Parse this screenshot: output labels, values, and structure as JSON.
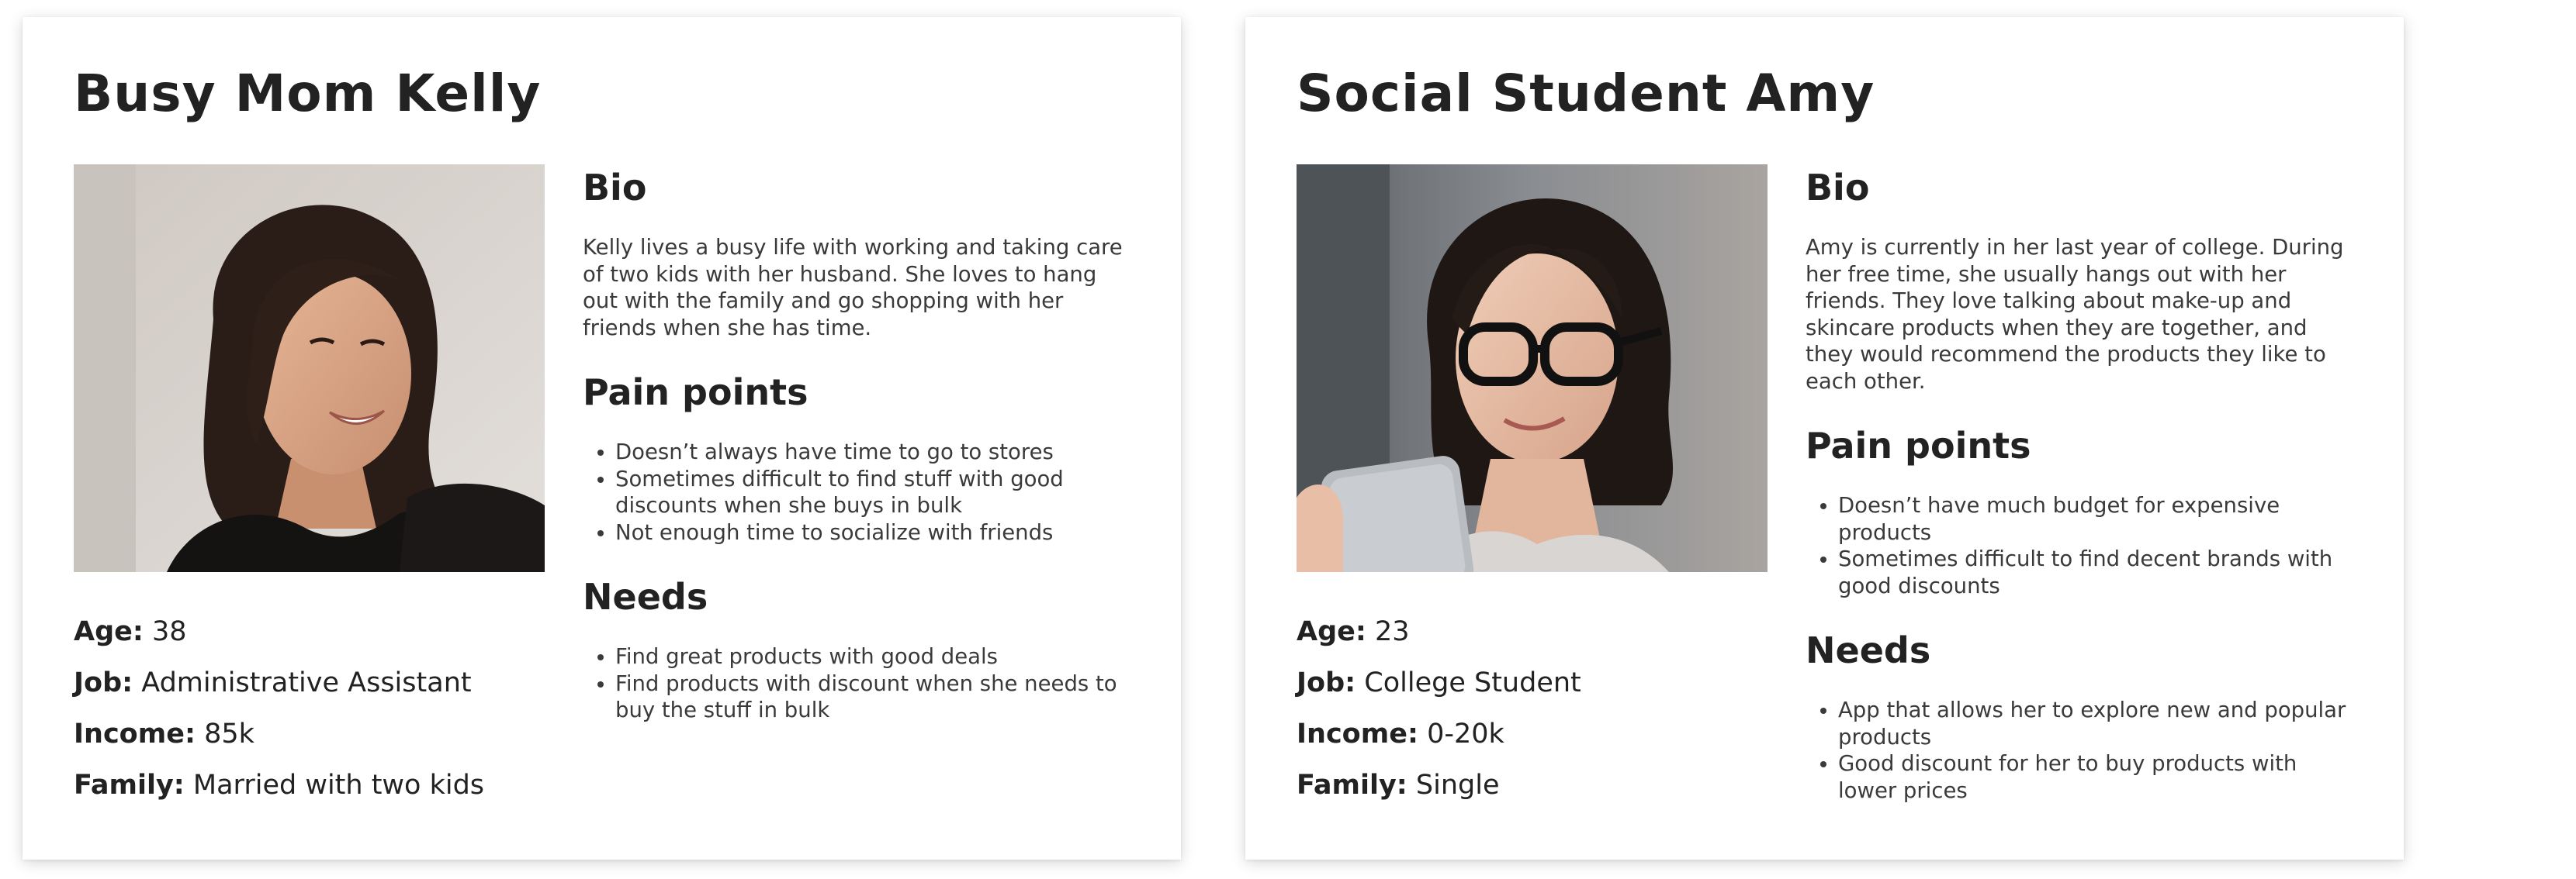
{
  "personas": [
    {
      "name": "Busy Mom Kelly",
      "photo_alt": "portrait-kelly",
      "facts": [
        {
          "key": "Age:",
          "value": "38"
        },
        {
          "key": "Job:",
          "value": "Administrative Assistant"
        },
        {
          "key": "Income:",
          "value": "85k"
        },
        {
          "key": "Family:",
          "value": "Married with two kids"
        }
      ],
      "bio_heading": "Bio",
      "bio": "Kelly lives a busy life with working and taking care of two kids with her husband. She loves to hang out with the family and go shopping with her friends when she has time.",
      "pain_heading": "Pain points",
      "pain_points": [
        "Doesn’t always have time to go to stores",
        "Sometimes difficult to find stuff with good discounts when she buys in bulk",
        "Not enough time to socialize with friends"
      ],
      "needs_heading": "Needs",
      "needs": [
        "Find great products with good deals",
        "Find products with discount when she needs to buy the stuff in bulk"
      ]
    },
    {
      "name": "Social Student Amy",
      "photo_alt": "portrait-amy",
      "facts": [
        {
          "key": "Age:",
          "value": "23"
        },
        {
          "key": "Job:",
          "value": "College Student"
        },
        {
          "key": "Income:",
          "value": "0-20k"
        },
        {
          "key": "Family:",
          "value": "Single"
        }
      ],
      "bio_heading": "Bio",
      "bio": "Amy is currently in her last year of college. During her free time, she usually hangs out with her friends. They love talking about make-up and skincare products when they are together, and they would recommend the products they like to each other.",
      "pain_heading": "Pain points",
      "pain_points": [
        "Doesn’t have much budget for expensive products",
        "Sometimes difficult to find decent brands with good discounts"
      ],
      "needs_heading": "Needs",
      "needs": [
        "App that allows her to explore new and popular products",
        "Good discount for her to buy products with lower prices"
      ]
    }
  ]
}
